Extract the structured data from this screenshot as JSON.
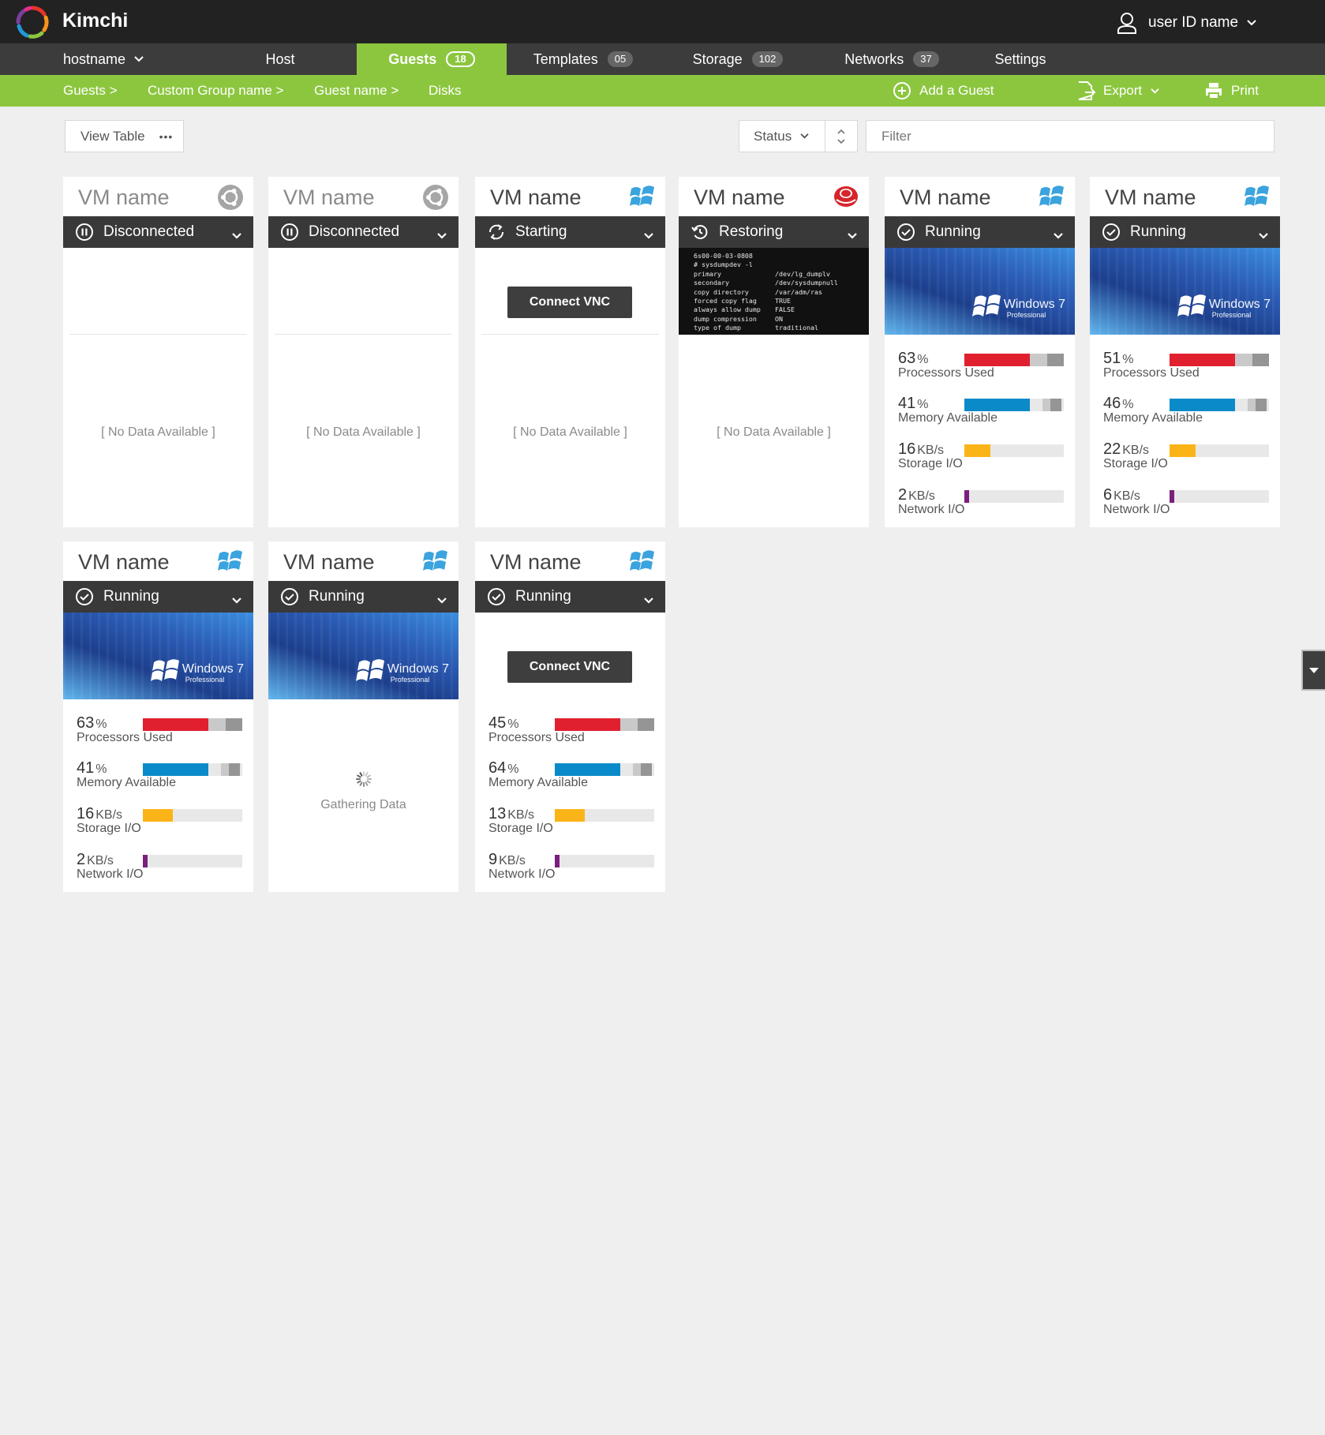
{
  "app": {
    "brand": "Kimchi",
    "user_name": "user ID name"
  },
  "nav": {
    "host_select": "hostname",
    "items": [
      {
        "label": "Host",
        "badge": ""
      },
      {
        "label": "Guests",
        "badge": "18"
      },
      {
        "label": "Templates",
        "badge": "05"
      },
      {
        "label": "Storage",
        "badge": "102"
      },
      {
        "label": "Networks",
        "badge": "37"
      },
      {
        "label": "Settings",
        "badge": ""
      }
    ],
    "active": "Guests"
  },
  "breadcrumb": [
    "Guests >",
    "Custom Group name >",
    "Guest name >",
    "Disks"
  ],
  "actions": {
    "add_guest": "Add a Guest",
    "export": "Export",
    "print": "Print"
  },
  "toolbar": {
    "view_table": "View Table",
    "view_table_more": "•••",
    "status_select": "Status",
    "filter_placeholder": "Filter"
  },
  "colors": {
    "accent_green": "#8cc63f",
    "top_bar": "#222222",
    "nav_bar": "#3c3c3c",
    "cpu": "#e0202e",
    "memory": "#0b8ac9",
    "storage": "#fbb418",
    "network": "#7a1f7e"
  },
  "labels": {
    "processors": "Processors Used",
    "memory": "Memory Available",
    "storage": "Storage I/O",
    "storage_spaced": "Storage  I/O",
    "network": "Network I/O",
    "no_data": "[ No Data Available ]",
    "gathering": "Gathering Data",
    "connect_vnc": "Connect VNC",
    "win_brand": "Windows 7",
    "win_edition": "Professional"
  },
  "guests": [
    {
      "name": "VM name",
      "os_icon": "ubuntu-icon",
      "status": "Disconnected",
      "status_icon": "pause-icon",
      "screen": "blank",
      "content": "no-data"
    },
    {
      "name": "VM name",
      "os_icon": "ubuntu-icon",
      "status": "Disconnected",
      "status_icon": "pause-icon",
      "screen": "blank",
      "content": "no-data"
    },
    {
      "name": "VM name",
      "os_icon": "windows-icon",
      "status": "Starting",
      "status_icon": "refresh-icon",
      "screen": "connect-vnc",
      "content": "no-data"
    },
    {
      "name": "VM name",
      "os_icon": "redhat-icon",
      "status": "Restoring",
      "status_icon": "restore-icon",
      "screen": "terminal",
      "content": "no-data",
      "terminal": {
        "header": [
          "6s00-00-03-0808",
          "# sysdumpdev -l"
        ],
        "rows": [
          [
            "primary",
            "/dev/lg_dumplv"
          ],
          [
            "secondary",
            "/dev/sysdumpnull"
          ],
          [
            "copy directory",
            "/var/adm/ras"
          ],
          [
            "forced copy flag",
            "TRUE"
          ],
          [
            "always allow dump",
            "FALSE"
          ],
          [
            "dump compression",
            "ON"
          ],
          [
            "type of dump",
            "traditional"
          ]
        ]
      }
    },
    {
      "name": "VM name",
      "os_icon": "windows-icon",
      "status": "Running",
      "status_icon": "check-icon",
      "screen": "win7",
      "content": "metrics",
      "cpu": {
        "value": "63",
        "unit": "%",
        "pct": 0.66
      },
      "memory": {
        "value": "41",
        "unit": "%",
        "pct": 0.66
      },
      "storage": {
        "value": "16",
        "unit": "KB/s",
        "pct": 0.26
      },
      "network": {
        "value": "2",
        "unit": "KB/s",
        "pct": 0.05
      }
    },
    {
      "name": "VM name",
      "os_icon": "windows-icon",
      "status": "Running",
      "status_icon": "check-icon",
      "screen": "win7",
      "content": "metrics",
      "cpu": {
        "value": "51",
        "unit": "%",
        "pct": 0.66
      },
      "memory": {
        "value": "46",
        "unit": "%",
        "pct": 0.66
      },
      "storage": {
        "value": "22",
        "unit": "KB/s",
        "pct": 0.26
      },
      "network": {
        "value": "6",
        "unit": "KB/s",
        "pct": 0.05
      }
    },
    {
      "name": "VM name",
      "os_icon": "windows-icon",
      "status": "Running",
      "status_icon": "check-icon",
      "screen": "win7",
      "content": "metrics",
      "cpu": {
        "value": "63",
        "unit": "%",
        "pct": 0.66
      },
      "memory": {
        "value": "41",
        "unit": "%",
        "pct": 0.66
      },
      "storage": {
        "value": "16",
        "unit": "KB/s",
        "pct": 0.3
      },
      "network": {
        "value": "2",
        "unit": "KB/s",
        "pct": 0.05
      }
    },
    {
      "name": "VM name",
      "os_icon": "windows-icon",
      "status": "Running",
      "status_icon": "check-icon",
      "screen": "win7",
      "content": "gathering"
    },
    {
      "name": "VM name",
      "os_icon": "windows-icon",
      "status": "Running",
      "status_icon": "check-icon",
      "screen": "connect-vnc",
      "content": "metrics",
      "cpu": {
        "value": "45",
        "unit": "%",
        "pct": 0.66
      },
      "memory": {
        "value": "64",
        "unit": "%",
        "pct": 0.66
      },
      "storage": {
        "value": "13",
        "unit": "KB/s",
        "pct": 0.3
      },
      "network": {
        "value": "9",
        "unit": "KB/s",
        "pct": 0.05
      }
    }
  ]
}
